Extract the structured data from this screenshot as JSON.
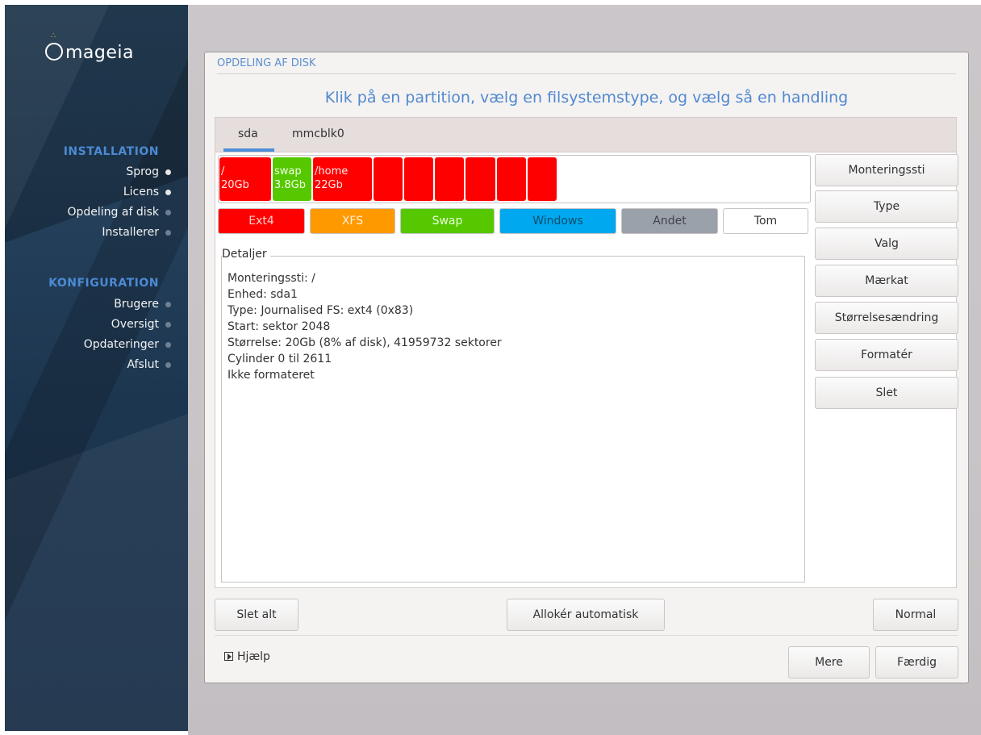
{
  "brand": {
    "logo_text": "mageia"
  },
  "sidebar": {
    "sections": [
      {
        "title": "INSTALLATION",
        "steps": [
          {
            "label": "Sprog",
            "state": "done"
          },
          {
            "label": "Licens",
            "state": "done"
          },
          {
            "label": "Opdeling af disk",
            "state": "todo"
          },
          {
            "label": "Installerer",
            "state": "todo"
          }
        ]
      },
      {
        "title": "KONFIGURATION",
        "steps": [
          {
            "label": "Brugere",
            "state": "todo"
          },
          {
            "label": "Oversigt",
            "state": "todo"
          },
          {
            "label": "Opdateringer",
            "state": "todo"
          },
          {
            "label": "Afslut",
            "state": "todo"
          }
        ]
      }
    ]
  },
  "window": {
    "title": "OPDELING AF DISK",
    "instruction": "Klik på en partition, vælg en filsystemstype, og vælg så en handling"
  },
  "tabs": [
    {
      "label": "sda",
      "selected": true
    },
    {
      "label": "mmcblk0",
      "selected": false
    }
  ],
  "partitions": [
    {
      "mount": "/",
      "size": "20Gb",
      "type": "ext4"
    },
    {
      "mount": "swap",
      "size": "3.8Gb",
      "type": "swap"
    },
    {
      "mount": "/home",
      "size": "22Gb",
      "type": "ext4"
    },
    {
      "mount": "",
      "size": "",
      "type": "ext4"
    },
    {
      "mount": "",
      "size": "",
      "type": "ext4"
    },
    {
      "mount": "",
      "size": "",
      "type": "ext4"
    },
    {
      "mount": "",
      "size": "",
      "type": "ext4"
    },
    {
      "mount": "",
      "size": "",
      "type": "ext4"
    },
    {
      "mount": "",
      "size": "",
      "type": "ext4"
    }
  ],
  "legend": [
    {
      "label": "Ext4",
      "bg": "#ff0000",
      "fg": "#ffd2d2"
    },
    {
      "label": "XFS",
      "bg": "#ff9900",
      "fg": "#fff0d8"
    },
    {
      "label": "Swap",
      "bg": "#55c800",
      "fg": "#eaffdb"
    },
    {
      "label": "Windows",
      "bg": "#00a8ef",
      "fg": "#0a4e6b"
    },
    {
      "label": "Andet",
      "bg": "#9aa1aa",
      "fg": "#3f444a"
    },
    {
      "label": "Tom",
      "bg": "#ffffff",
      "fg": "#333333"
    }
  ],
  "details": {
    "label": "Detaljer",
    "lines": [
      "Monteringssti: /",
      "Enhed: sda1",
      "Type: Journalised FS: ext4 (0x83)",
      "Start: sektor 2048",
      "Størrelse: 20Gb (8% af disk), 41959732 sektorer",
      "Cylinder 0 til 2611",
      "Ikke formateret"
    ]
  },
  "actions": [
    "Monteringssti",
    "Type",
    "Valg",
    "Mærkat",
    "Størrelsesændring",
    "Formatér",
    "Slet"
  ],
  "bottom": {
    "clear_all": "Slet alt",
    "auto_allocate": "Allokér automatisk",
    "mode": "Normal"
  },
  "footer": {
    "help": "Hjælp",
    "more": "Mere",
    "done": "Færdig"
  }
}
